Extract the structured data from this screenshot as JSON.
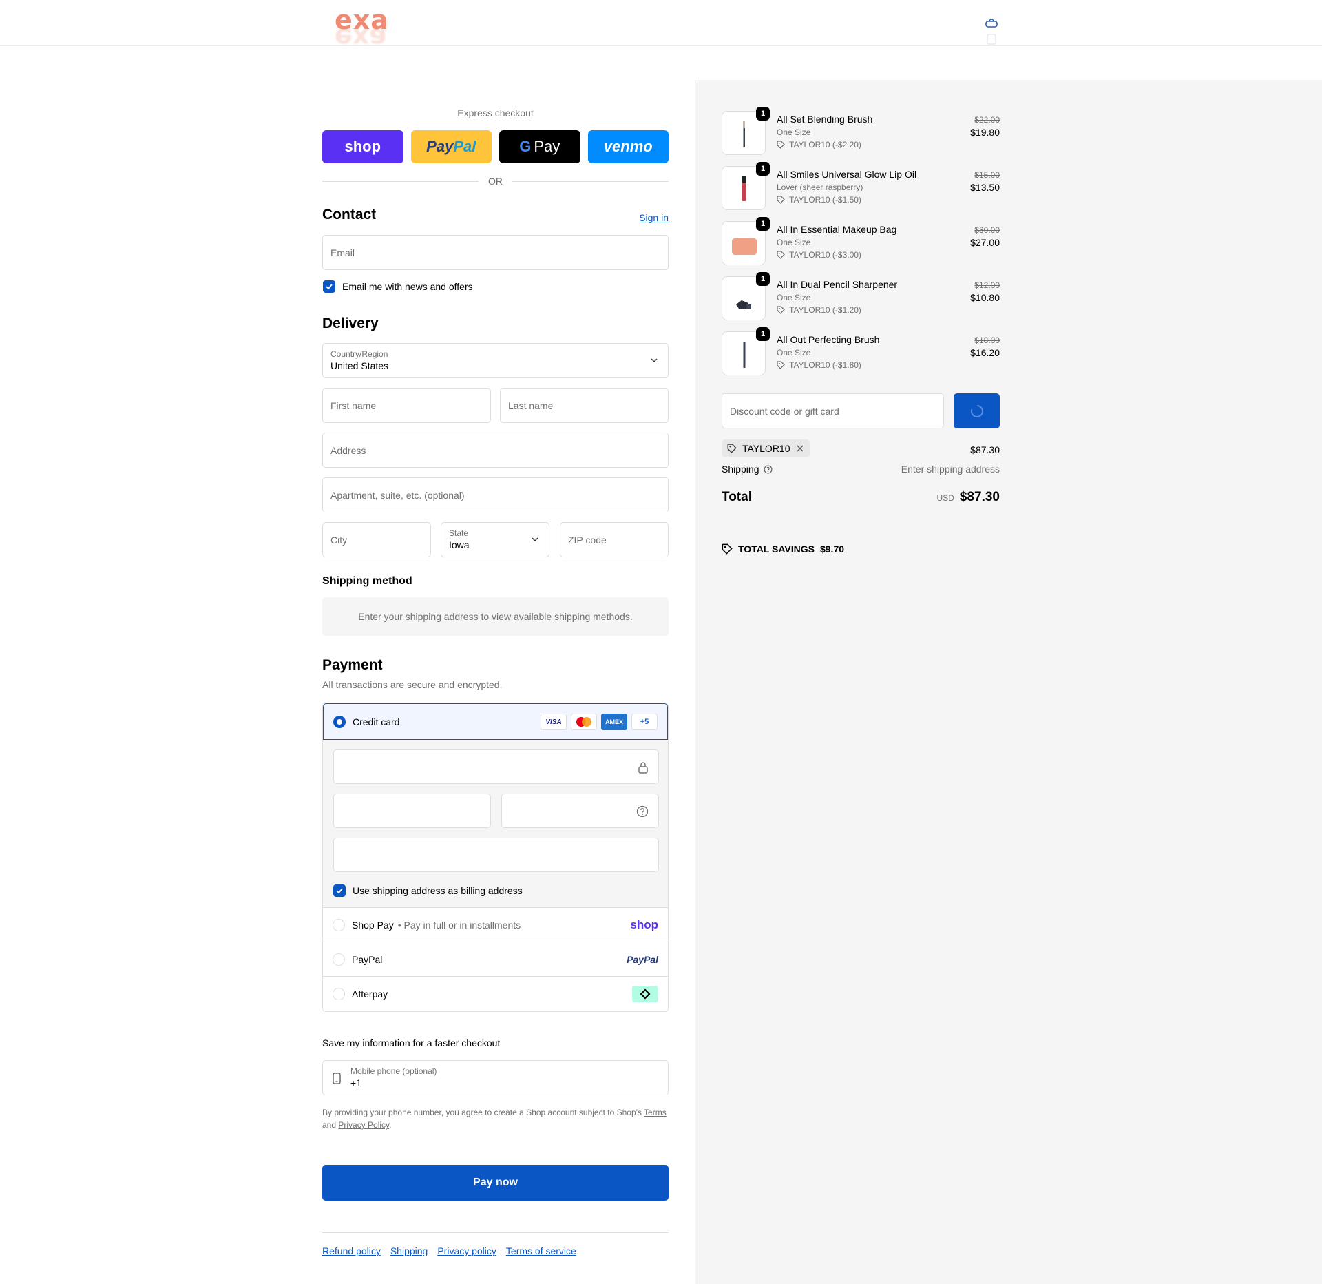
{
  "header": {
    "logo": "exa"
  },
  "express": {
    "title": "Express checkout",
    "shop": "shop",
    "paypal_a": "Pay",
    "paypal_b": "Pal",
    "gpay_g": "G",
    "gpay": "Pay",
    "venmo": "venmo",
    "or": "OR"
  },
  "contact": {
    "title": "Contact",
    "sign_in": "Sign in",
    "email_placeholder": "Email",
    "news_label": "Email me with news and offers"
  },
  "delivery": {
    "title": "Delivery",
    "country_label": "Country/Region",
    "country_value": "United States",
    "first_name": "First name",
    "last_name": "Last name",
    "address": "Address",
    "apartment": "Apartment, suite, etc. (optional)",
    "city": "City",
    "state_label": "State",
    "state_value": "Iowa",
    "zip": "ZIP code"
  },
  "shipping_method": {
    "title": "Shipping method",
    "message": "Enter your shipping address to view available shipping methods."
  },
  "payment": {
    "title": "Payment",
    "subtitle": "All transactions are secure and encrypted.",
    "credit_card": "Credit card",
    "cards": {
      "visa": "VISA",
      "amex": "AMEX",
      "more": "+5"
    },
    "billing_label": "Use shipping address as billing address",
    "options": [
      {
        "name": "Shop Pay",
        "sub": "• Pay in full or in installments",
        "brand": "shop"
      },
      {
        "name": "PayPal",
        "sub": "",
        "brand": "PayPal"
      },
      {
        "name": "Afterpay",
        "sub": "",
        "brand": ""
      }
    ]
  },
  "save_info": {
    "title": "Save my information for a faster checkout",
    "phone_label": "Mobile phone (optional)",
    "phone_value": "+1",
    "legal_a": "By providing your phone number, you agree to create a Shop account subject to Shop's ",
    "terms": "Terms",
    "legal_b": "and ",
    "privacy": "Privacy Policy",
    "legal_c": "."
  },
  "pay_now": "Pay now",
  "footer": {
    "links": [
      "Refund policy",
      "Shipping",
      "Privacy policy",
      "Terms of service"
    ]
  },
  "cart": {
    "items": [
      {
        "name": "All Set Blending Brush",
        "variant": "One Size",
        "discount": "TAYLOR10 (-$2.20)",
        "old_price": "$22.00",
        "price": "$19.80",
        "qty": "1"
      },
      {
        "name": "All Smiles Universal Glow Lip Oil",
        "variant": "Lover (sheer raspberry)",
        "discount": "TAYLOR10 (-$1.50)",
        "old_price": "$15.00",
        "price": "$13.50",
        "qty": "1"
      },
      {
        "name": "All In Essential Makeup Bag",
        "variant": "One Size",
        "discount": "TAYLOR10 (-$3.00)",
        "old_price": "$30.00",
        "price": "$27.00",
        "qty": "1"
      },
      {
        "name": "All In Dual Pencil Sharpener",
        "variant": "One Size",
        "discount": "TAYLOR10 (-$1.20)",
        "old_price": "$12.00",
        "price": "$10.80",
        "qty": "1"
      },
      {
        "name": "All Out Perfecting Brush",
        "variant": "One Size",
        "discount": "TAYLOR10 (-$1.80)",
        "old_price": "$18.00",
        "price": "$16.20",
        "qty": "1"
      }
    ],
    "discount_placeholder": "Discount code or gift card",
    "applied_code": "TAYLOR10",
    "subtotal": "$87.30",
    "shipping_label": "Shipping",
    "shipping_value": "Enter shipping address",
    "total_label": "Total",
    "currency": "USD",
    "total": "$87.30",
    "savings_label": "TOTAL SAVINGS",
    "savings_value": "$9.70"
  },
  "colors": {
    "accent": "#0a56c4",
    "brand": "#f08a72",
    "shop": "#5a31f4",
    "afterpay": "#b2fce4"
  }
}
